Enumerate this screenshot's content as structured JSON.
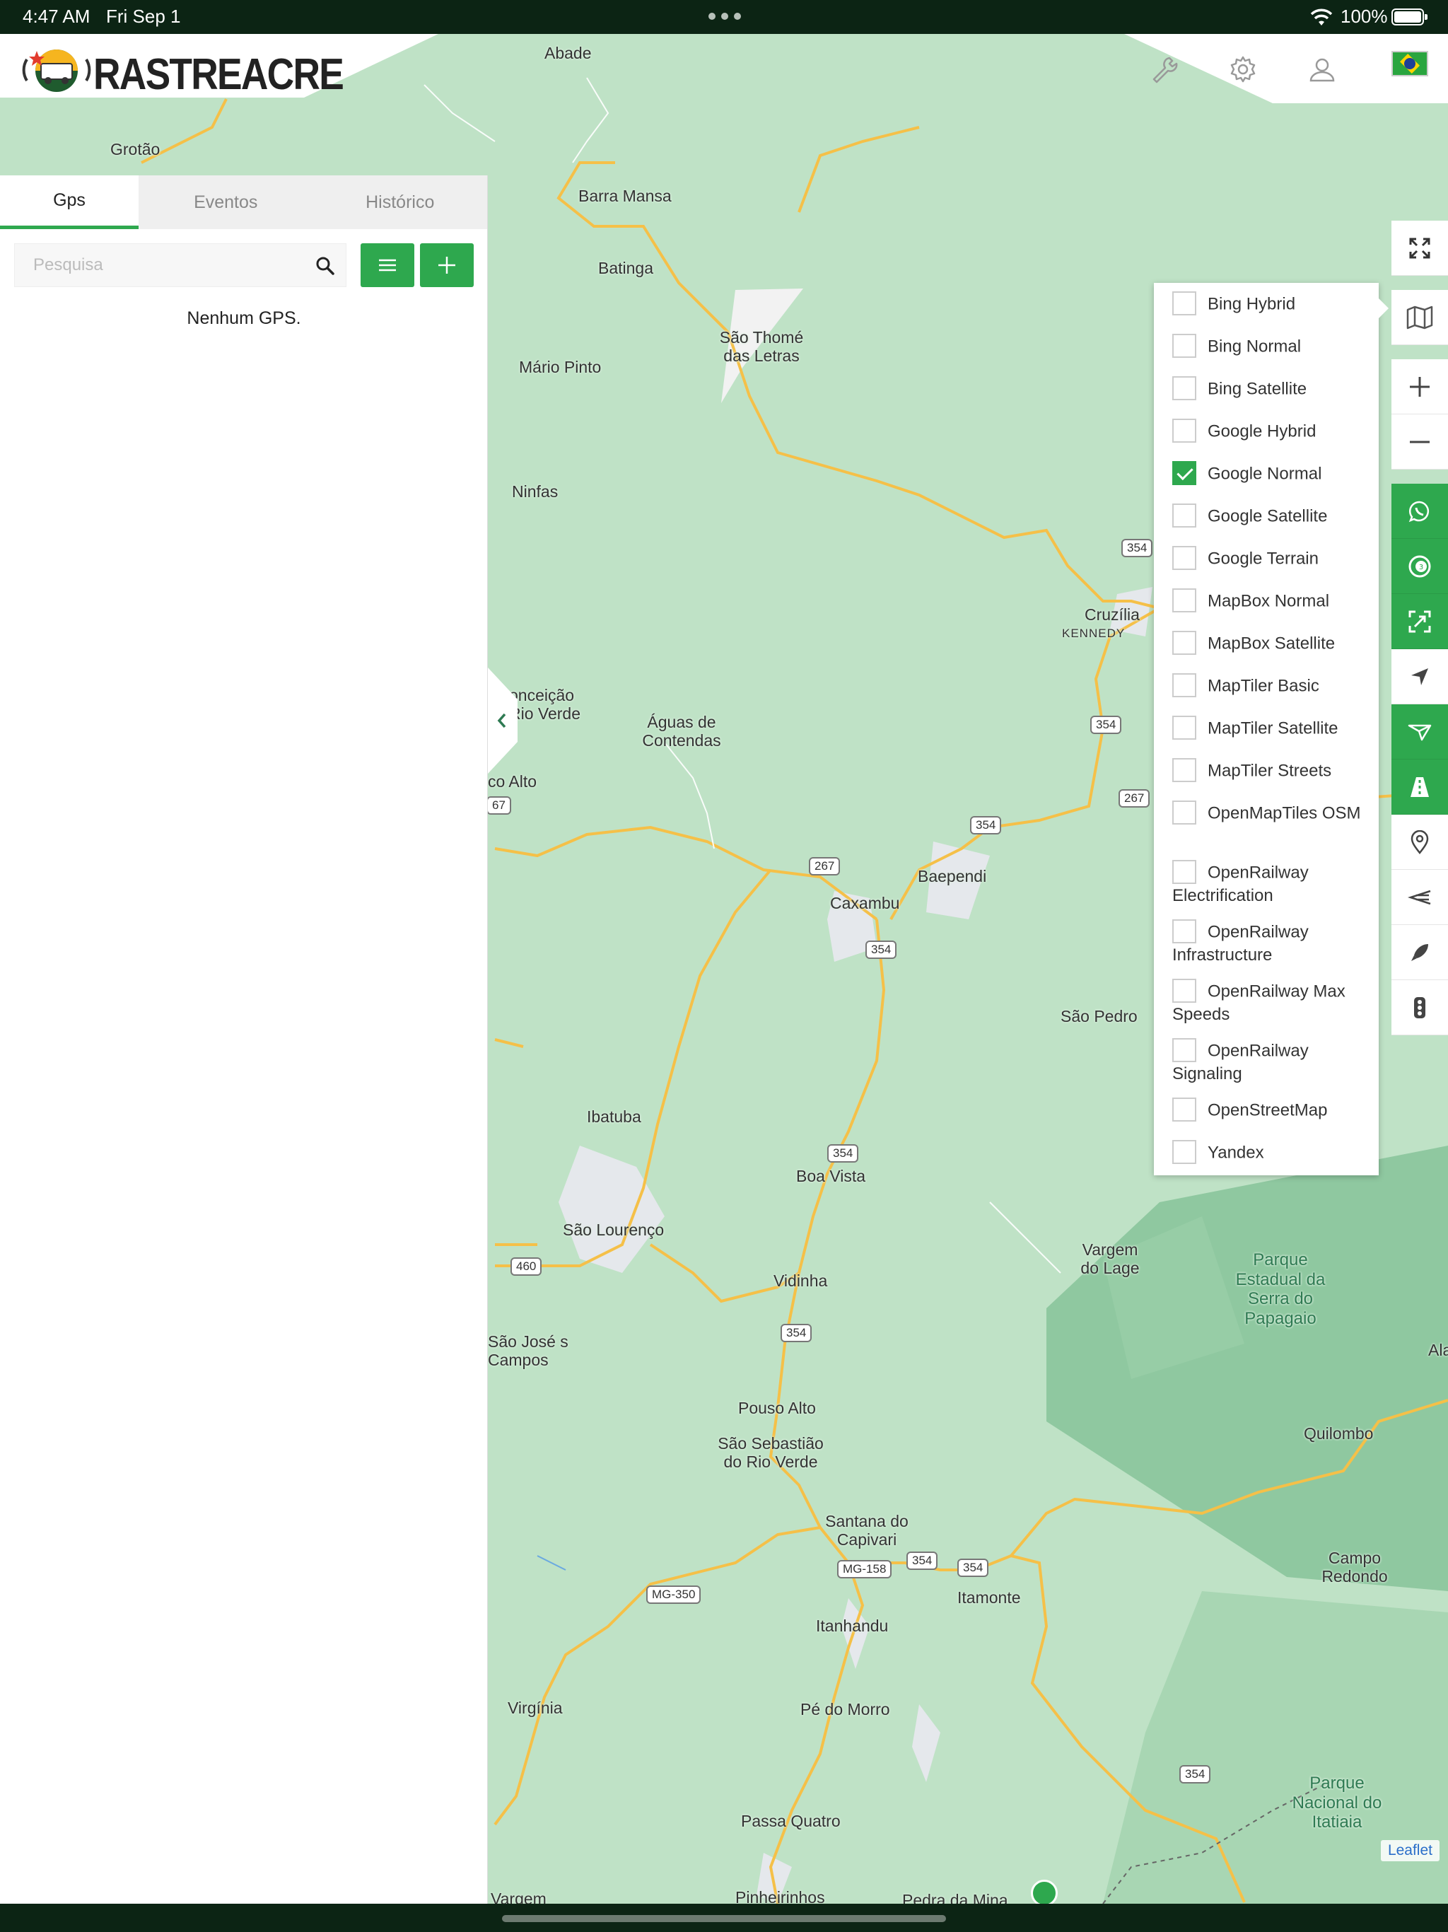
{
  "status_bar": {
    "time": "4:47 AM",
    "date": "Fri Sep 1",
    "battery": "100%"
  },
  "header": {
    "logo_text": "RASTREACRE",
    "icons": [
      "wrench-icon",
      "gear-icon",
      "user-icon"
    ],
    "flag": "brazil-flag"
  },
  "panel": {
    "tabs": [
      {
        "label": "Gps",
        "active": true
      },
      {
        "label": "Eventos",
        "active": false
      },
      {
        "label": "Histórico",
        "active": false
      }
    ],
    "search_placeholder": "Pesquisa",
    "empty_message": "Nenhum GPS."
  },
  "layers": [
    {
      "label": "Bing Hybrid",
      "checked": false
    },
    {
      "label": "Bing Normal",
      "checked": false
    },
    {
      "label": "Bing Satellite",
      "checked": false
    },
    {
      "label": "Google Hybrid",
      "checked": false
    },
    {
      "label": "Google Normal",
      "checked": true
    },
    {
      "label": "Google Satellite",
      "checked": false
    },
    {
      "label": "Google Terrain",
      "checked": false
    },
    {
      "label": "MapBox Normal",
      "checked": false
    },
    {
      "label": "MapBox Satellite",
      "checked": false
    },
    {
      "label": "MapTiler Basic",
      "checked": false
    },
    {
      "label": "MapTiler Satellite",
      "checked": false
    },
    {
      "label": "MapTiler Streets",
      "checked": false
    },
    {
      "label": "OpenMapTiles OSM",
      "checked": false
    },
    {
      "label": "OpenRailway Electrification",
      "checked": false
    },
    {
      "label": "OpenRailway Infrastructure",
      "checked": false
    },
    {
      "label": "OpenRailway Max Speeds",
      "checked": false
    },
    {
      "label": "OpenRailway Signaling",
      "checked": false
    },
    {
      "label": "OpenStreetMap",
      "checked": false
    },
    {
      "label": "Yandex",
      "checked": false
    }
  ],
  "map": {
    "attribution": "Leaflet",
    "places": [
      "Abade",
      "Grotão",
      "Barra Mansa",
      "Batinga",
      "São Thomé das Letras",
      "Mário Pinto",
      "Ninfas",
      "Cruzília",
      "KENNEDY",
      "onceição Rio Verde",
      "Águas de Contendas",
      "co Alto",
      "Baependi",
      "Caxambu",
      "São Pedro",
      "Ibatuba",
      "Boa Vista",
      "São Lourenço",
      "Vargem do Lage",
      "Parque Estadual da Serra do Papagaio",
      "Vidinha",
      "São José s Campos",
      "Ala",
      "Pouso Alto",
      "São Sebastião do Rio Verde",
      "Quilombo",
      "Santana do Capivari",
      "Campo Redondo",
      "Itamonte",
      "Itanhandu",
      "Virgínia",
      "Pé do Morro",
      "Passa Quatro",
      "Parque Nacional do Itatiaia",
      "Vargem",
      "Pinheirinhos",
      "Pedra da Mina"
    ],
    "road_shields": [
      "354",
      "354",
      "354",
      "267",
      "267",
      "354",
      "267",
      "354",
      "354",
      "460",
      "354",
      "MG-158",
      "354",
      "354",
      "MG-350",
      "354",
      "67"
    ]
  },
  "toolbar": [
    "fullscreen-icon",
    "map-layers-icon",
    "zoom-in-icon",
    "zoom-out-icon",
    "whatsapp-icon",
    "counter-icon",
    "scan-icon",
    "navigate-icon",
    "send-icon",
    "road-icon",
    "pin-icon",
    "route-back-icon",
    "rocket-icon",
    "traffic-light-icon"
  ],
  "colors": {
    "accent": "#2ea84e",
    "map_bg": "#bfe2c6",
    "road": "#f5c048",
    "statusbar": "#0c2414"
  }
}
